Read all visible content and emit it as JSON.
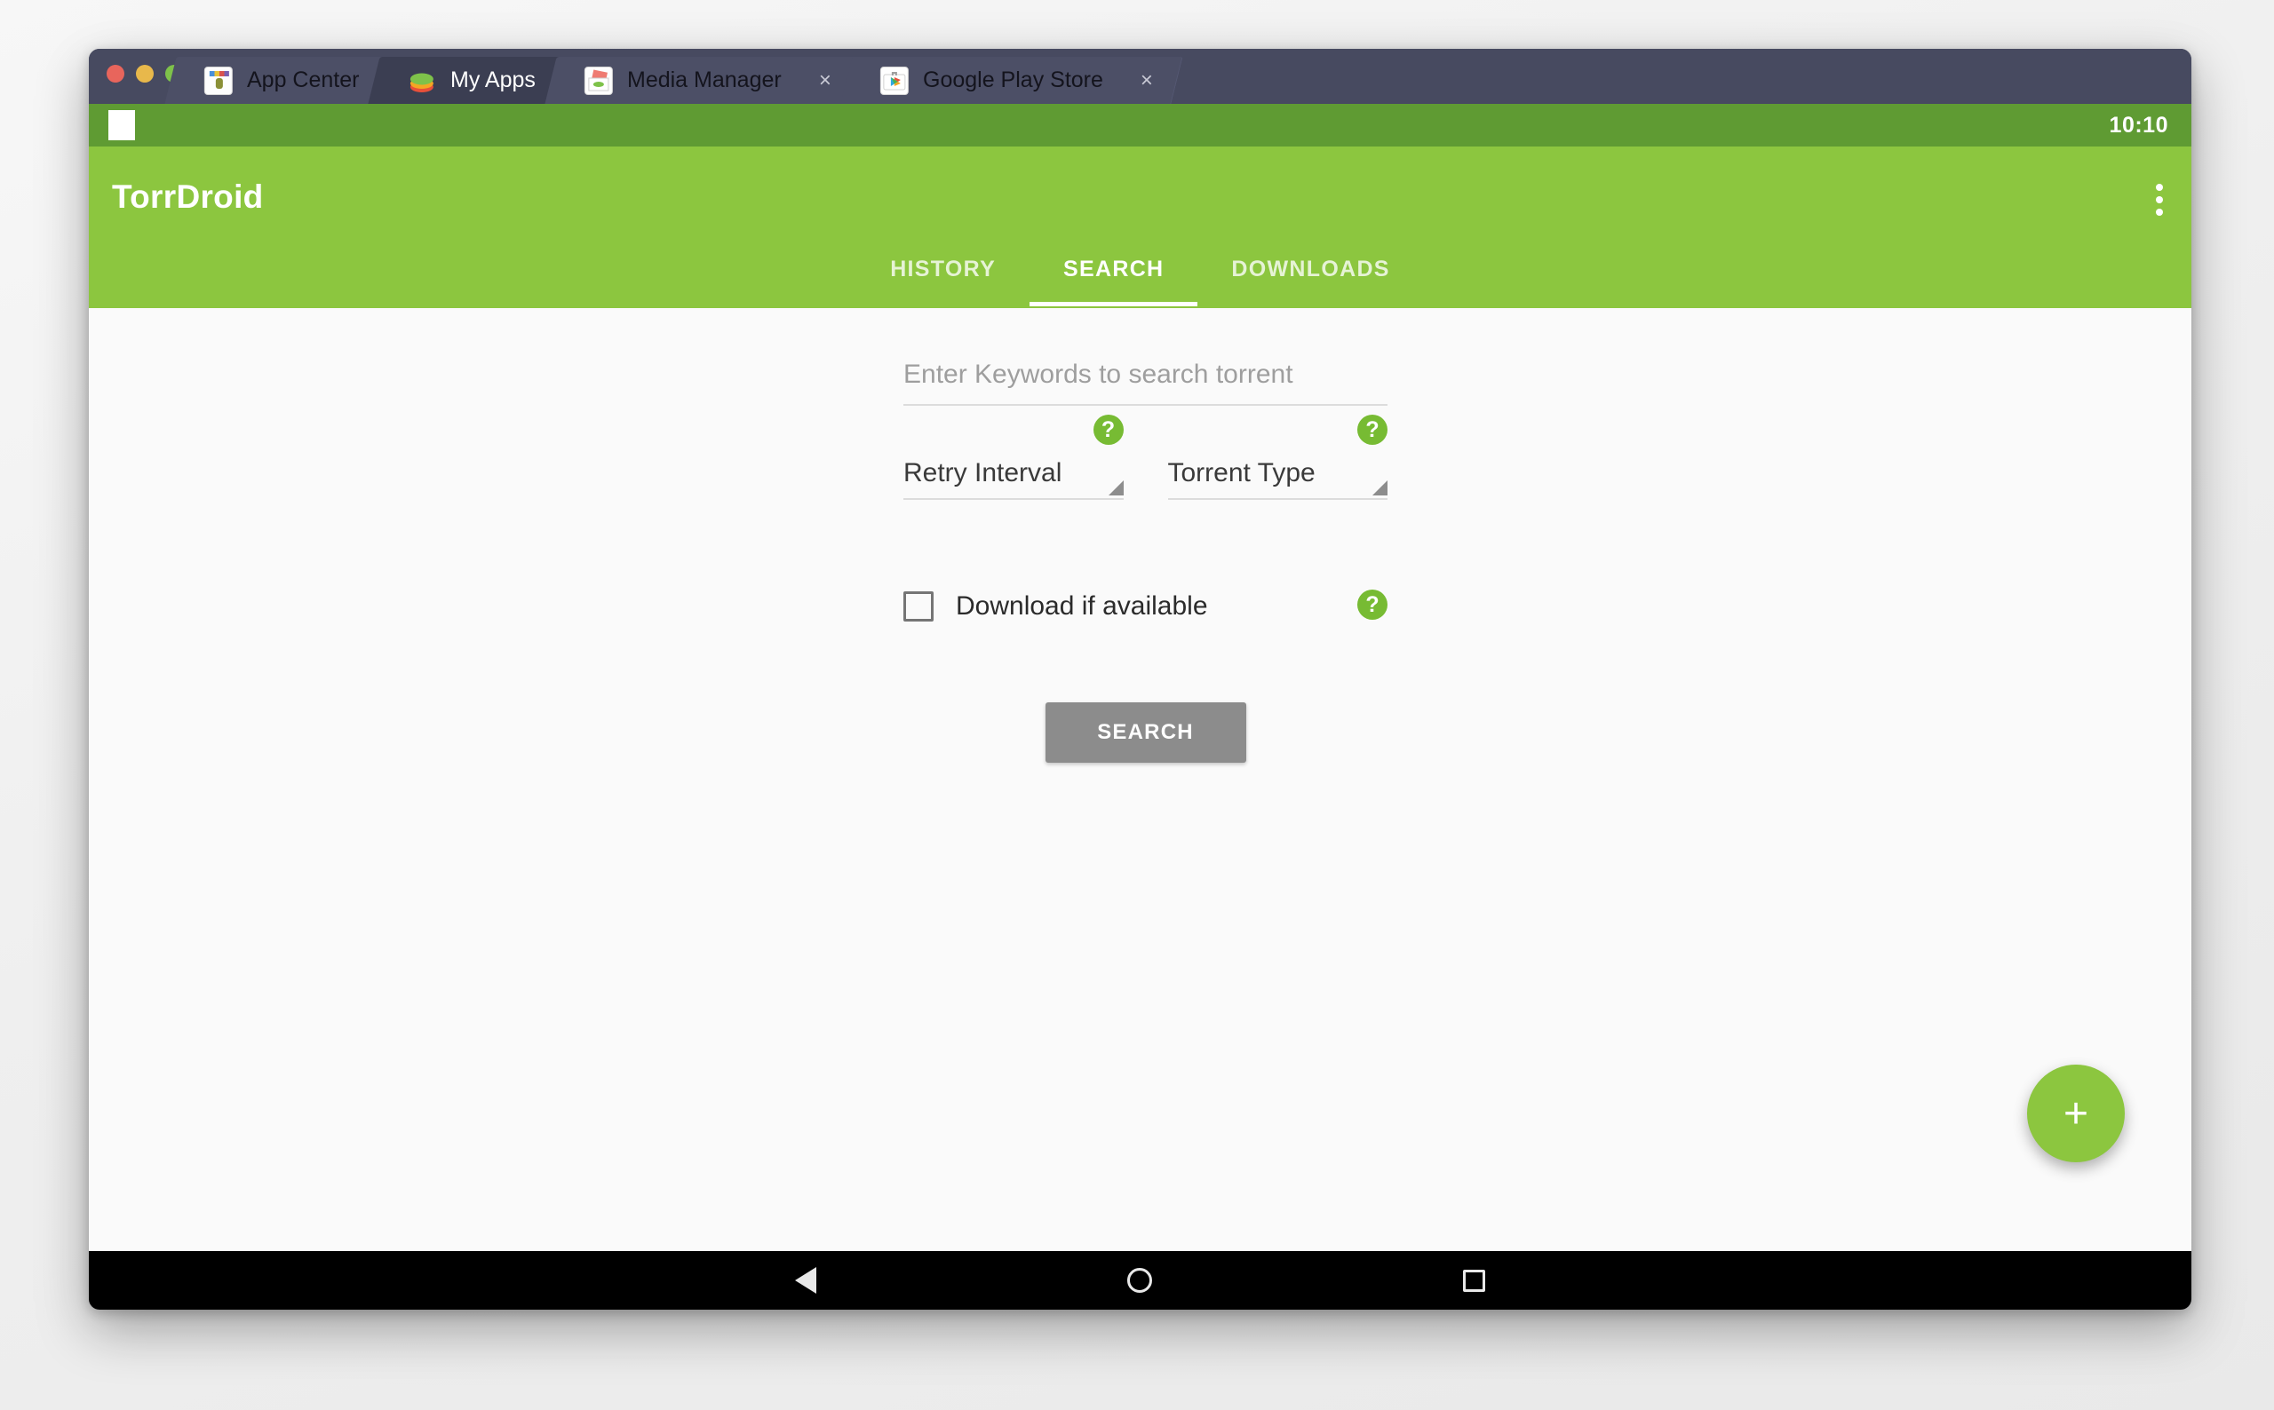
{
  "window": {
    "traffic_lights": [
      "close",
      "minimize",
      "zoom"
    ],
    "tabs": [
      {
        "label": "App Center",
        "icon": "app-center-icon",
        "active": false,
        "closable": false
      },
      {
        "label": "My Apps",
        "icon": "bluestacks-layers-icon",
        "active": true,
        "closable": false
      },
      {
        "label": "Media Manager",
        "icon": "media-manager-icon",
        "active": false,
        "closable": true,
        "close_label": "×"
      },
      {
        "label": "Google Play Store",
        "icon": "google-play-icon",
        "active": false,
        "closable": true,
        "close_label": "×"
      }
    ]
  },
  "status_bar": {
    "clock": "10:10",
    "notification_icon": "white-square-notification-icon"
  },
  "app_bar": {
    "title": "TorrDroid",
    "overflow_menu": "more-options",
    "accent_color": "#8cc63f",
    "status_color": "#5f9b33"
  },
  "app_tabs": [
    {
      "label": "HISTORY",
      "selected": false
    },
    {
      "label": "SEARCH",
      "selected": true
    },
    {
      "label": "DOWNLOADS",
      "selected": false
    }
  ],
  "search_form": {
    "keywords_placeholder": "Enter Keywords to search torrent",
    "keywords_value": "",
    "retry_interval": {
      "label": "Retry Interval",
      "help": "?"
    },
    "torrent_type": {
      "label": "Torrent Type",
      "help": "?"
    },
    "download_if_available": {
      "label": "Download if available",
      "checked": false,
      "help": "?"
    },
    "submit_label": "SEARCH"
  },
  "fab": {
    "label": "+",
    "color": "#8cc63f"
  },
  "nav_bar": {
    "back": "back-triangle",
    "home": "home-circle",
    "recents": "recents-square"
  }
}
